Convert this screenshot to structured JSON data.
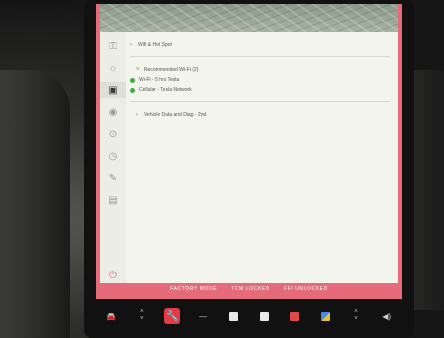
{
  "sidebar": {
    "icons": [
      {
        "name": "lock-icon",
        "glyph": "⚿",
        "active": false
      },
      {
        "name": "lights-icon",
        "glyph": "☼",
        "active": false
      },
      {
        "name": "display-icon",
        "glyph": "▣",
        "active": true
      },
      {
        "name": "driving-icon",
        "glyph": "◉",
        "active": false
      },
      {
        "name": "steering-icon",
        "glyph": "⊙",
        "active": false
      },
      {
        "name": "schedule-icon",
        "glyph": "◷",
        "active": false
      },
      {
        "name": "service-icon",
        "glyph": "✎",
        "active": false
      },
      {
        "name": "software-icon",
        "glyph": "▤",
        "active": false
      }
    ],
    "exit_glyph": "⏻"
  },
  "content": {
    "first_row": "Wifi & Hot Spot",
    "section_header": "Recommended Wi-Fi (2)",
    "options": [
      "Wi-Fi - 5 hrs Tesla",
      "Cellular - Tesla Network"
    ],
    "last_row": "Vehicle Data and Diag - 2nd"
  },
  "status_bar": {
    "items": [
      "FACTORY MODE",
      "TCM LOCKED",
      "FFI UNLOCKED"
    ]
  },
  "dock": {
    "car_glyph": "🚘",
    "wrench_glyph": "🔧",
    "dash_glyph": "—",
    "temp_up": "˄",
    "temp_down": "˅",
    "volume_glyph": "◀)"
  }
}
